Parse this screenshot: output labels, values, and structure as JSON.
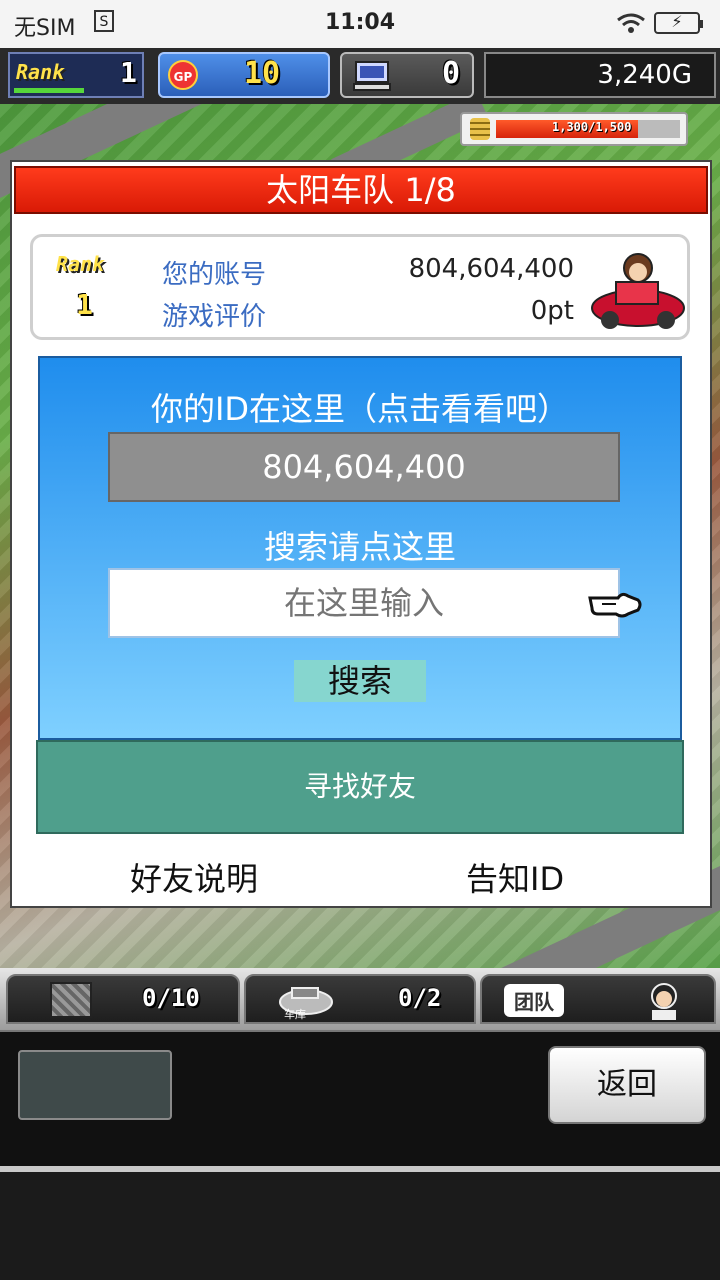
{
  "status_bar": {
    "carrier": "无SIM",
    "sim_icon_text": "S",
    "time": "11:04"
  },
  "hud": {
    "rank_label": "Rank",
    "rank_value": "1",
    "gp_label": "GP",
    "gp_value": "10",
    "pc_value": "0",
    "money": "3,240G",
    "capacity_text": "1,300/1,500",
    "capacity_fraction": 0.867
  },
  "dialog": {
    "title": "太阳车队 1/8",
    "info": {
      "rank_label": "Rank",
      "rank_value": "1",
      "account_label": "您的账号",
      "account_value": "804,604,400",
      "rating_label": "游戏评价",
      "rating_value": "0pt"
    },
    "id_prompt": "你的ID在这里（点击看看吧）",
    "id_value": "804,604,400",
    "search_prompt": "搜索请点这里",
    "search_placeholder": "在这里输入",
    "search_button": "搜索",
    "find_friends_button": "寻找好友",
    "friend_help_link": "好友说明",
    "share_id_link": "告知ID"
  },
  "bottom_bar": {
    "items_count": "0/10",
    "garage_label": "车库",
    "garage_count": "0/2",
    "team_label": "团队"
  },
  "back_button": "返回"
}
